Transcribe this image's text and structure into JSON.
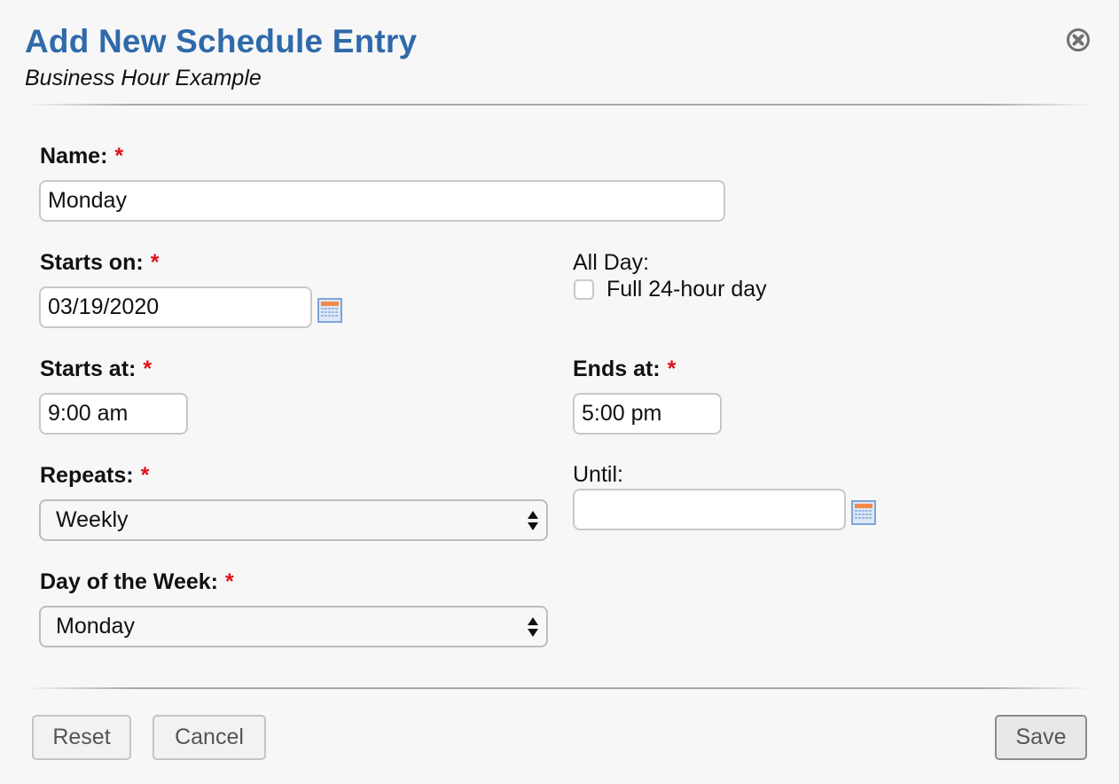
{
  "dialog": {
    "title": "Add New Schedule Entry",
    "subtitle": "Business Hour Example",
    "close_icon": "close-circle-icon"
  },
  "form": {
    "required_marker": "*",
    "name": {
      "label": "Name:",
      "value": "Monday",
      "required": true
    },
    "starts_on": {
      "label": "Starts on:",
      "value": "03/19/2020",
      "required": true,
      "icon": "calendar-icon"
    },
    "all_day": {
      "label": "All Day:",
      "checkbox_label": "Full 24-hour day",
      "checked": false
    },
    "starts_at": {
      "label": "Starts at:",
      "value": "9:00 am",
      "required": true
    },
    "ends_at": {
      "label": "Ends at:",
      "value": "5:00 pm",
      "required": true
    },
    "repeats": {
      "label": "Repeats:",
      "selected": "Weekly",
      "required": true
    },
    "until": {
      "label": "Until:",
      "value": "",
      "icon": "calendar-icon"
    },
    "day_of_week": {
      "label": "Day of the Week:",
      "selected": "Monday",
      "required": true
    }
  },
  "footer": {
    "reset_label": "Reset",
    "cancel_label": "Cancel",
    "save_label": "Save"
  },
  "colors": {
    "title": "#2f6aaa",
    "required": "#e0121b",
    "background": "#f7f7f7"
  }
}
